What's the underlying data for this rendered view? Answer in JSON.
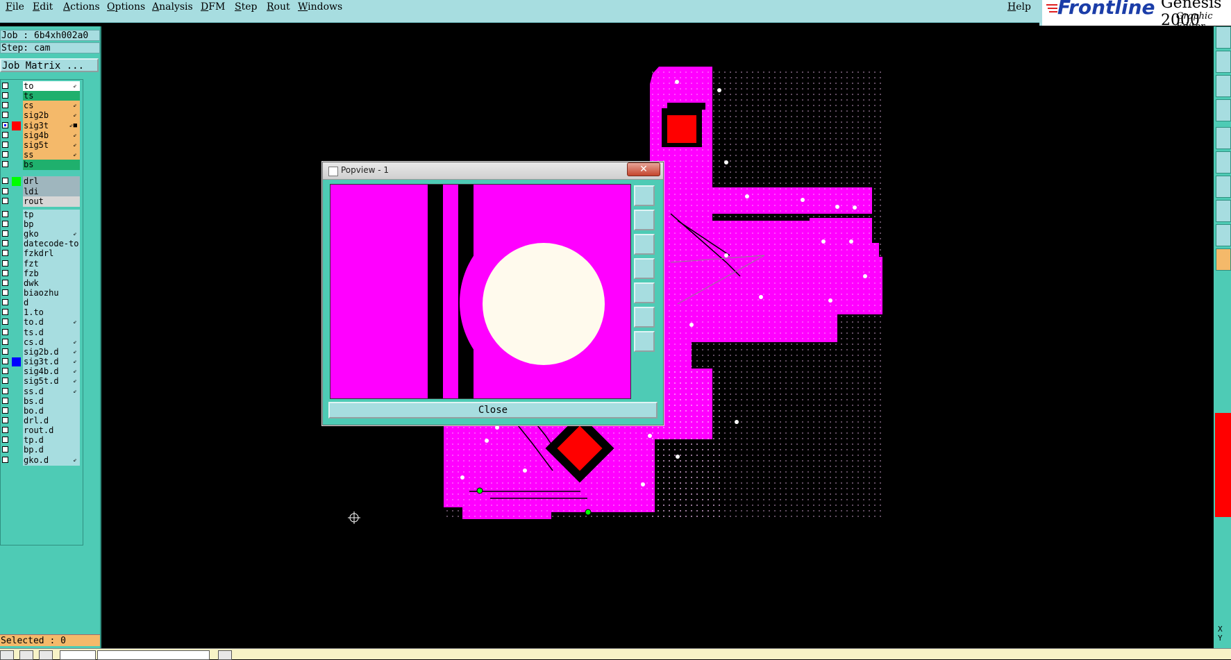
{
  "menu": {
    "items": [
      "File",
      "Edit",
      "Actions",
      "Options",
      "Analysis",
      "DFM",
      "Step",
      "Rout",
      "Windows"
    ],
    "help": "Help"
  },
  "brand": {
    "logo": "Frontline",
    "product": "Genesis 2000",
    "subtitle": "Graphic Editor"
  },
  "job": {
    "job_label": "Job : 6b4xh002a0",
    "step_label": "Step: cam",
    "matrix_button": "Job Matrix ..."
  },
  "layers": [
    {
      "name": "to",
      "color": "#ffffff",
      "mark": "⇙"
    },
    {
      "name": "ts",
      "color": "#1fb06d",
      "mark": ""
    },
    {
      "name": "cs",
      "color": "#f4b96a",
      "mark": "⇙"
    },
    {
      "name": "sig2b",
      "color": "#f4b96a",
      "mark": "⇙"
    },
    {
      "name": "sig3t",
      "color": "#f4b96a",
      "mark": "⇙■",
      "swatch": "#ff0000",
      "checked": true
    },
    {
      "name": "sig4b",
      "color": "#f4b96a",
      "mark": "⇙"
    },
    {
      "name": "sig5t",
      "color": "#f4b96a",
      "mark": "⇙"
    },
    {
      "name": "ss",
      "color": "#f4b96a",
      "mark": "⇙"
    },
    {
      "name": "bs",
      "color": "#1fb06d",
      "mark": ""
    },
    {
      "name": "drl",
      "color": "#9fb6be",
      "mark": "",
      "swatch": "#00ff00"
    },
    {
      "name": "ldi",
      "color": "#9fb6be",
      "mark": ""
    },
    {
      "name": "rout",
      "color": "#d6d6d6",
      "mark": ""
    },
    {
      "name": "tp",
      "color": "#a7dde0",
      "mark": ""
    },
    {
      "name": "bp",
      "color": "#a7dde0",
      "mark": ""
    },
    {
      "name": "gko",
      "color": "#a7dde0",
      "mark": "⇙"
    },
    {
      "name": "datecode-to",
      "color": "#a7dde0",
      "mark": ""
    },
    {
      "name": "fzkdrl",
      "color": "#a7dde0",
      "mark": ""
    },
    {
      "name": "fzt",
      "color": "#a7dde0",
      "mark": ""
    },
    {
      "name": "fzb",
      "color": "#a7dde0",
      "mark": ""
    },
    {
      "name": "dwk",
      "color": "#a7dde0",
      "mark": ""
    },
    {
      "name": "biaozhu",
      "color": "#a7dde0",
      "mark": ""
    },
    {
      "name": "d",
      "color": "#a7dde0",
      "mark": ""
    },
    {
      "name": "1.to",
      "color": "#a7dde0",
      "mark": ""
    },
    {
      "name": "to.d",
      "color": "#a7dde0",
      "mark": "⇙"
    },
    {
      "name": "ts.d",
      "color": "#a7dde0",
      "mark": ""
    },
    {
      "name": "cs.d",
      "color": "#a7dde0",
      "mark": "⇙"
    },
    {
      "name": "sig2b.d",
      "color": "#a7dde0",
      "mark": "⇙"
    },
    {
      "name": "sig3t.d",
      "color": "#a7dde0",
      "mark": "⇙",
      "swatch": "#0000ff"
    },
    {
      "name": "sig4b.d",
      "color": "#a7dde0",
      "mark": "⇙"
    },
    {
      "name": "sig5t.d",
      "color": "#a7dde0",
      "mark": "⇙"
    },
    {
      "name": "ss.d",
      "color": "#a7dde0",
      "mark": "⇙"
    },
    {
      "name": "bs.d",
      "color": "#a7dde0",
      "mark": ""
    },
    {
      "name": "bo.d",
      "color": "#a7dde0",
      "mark": ""
    },
    {
      "name": "drl.d",
      "color": "#a7dde0",
      "mark": ""
    },
    {
      "name": "rout.d",
      "color": "#a7dde0",
      "mark": ""
    },
    {
      "name": "tp.d",
      "color": "#a7dde0",
      "mark": ""
    },
    {
      "name": "bp.d",
      "color": "#a7dde0",
      "mark": ""
    },
    {
      "name": "gko.d",
      "color": "#a7dde0",
      "mark": "⇙"
    }
  ],
  "status": {
    "selected": "Selected : 0",
    "xy_x": "X",
    "xy_y": "Y"
  },
  "popview": {
    "title": "Popview - 1",
    "close_x": "✕",
    "close_button": "Close",
    "tools": [
      "zoom-fit-icon",
      "zoom-in-icon",
      "zoom-out-icon",
      "pan-left-icon",
      "pan-right-icon",
      "fit-all-icon",
      "fit-vertical-icon"
    ]
  },
  "colors": {
    "board": "#ff00ff",
    "pad": "#ff0000",
    "drill": "#fffaed",
    "panel": "#4ecbb5",
    "field": "#a7dde0"
  }
}
